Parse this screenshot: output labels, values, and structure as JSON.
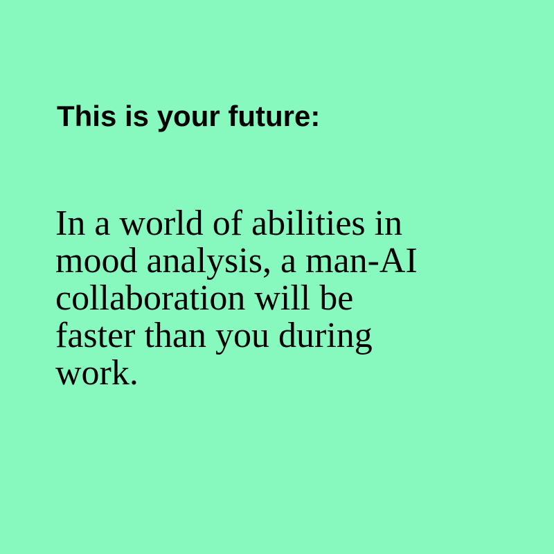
{
  "colors": {
    "background": "#87F9BF",
    "text": "#000000"
  },
  "heading": "This is your future:",
  "body_lines": [
    "In a world of abilities in",
    "mood analysis, a man-AI",
    "collaboration will be",
    "faster than you during",
    "work."
  ]
}
